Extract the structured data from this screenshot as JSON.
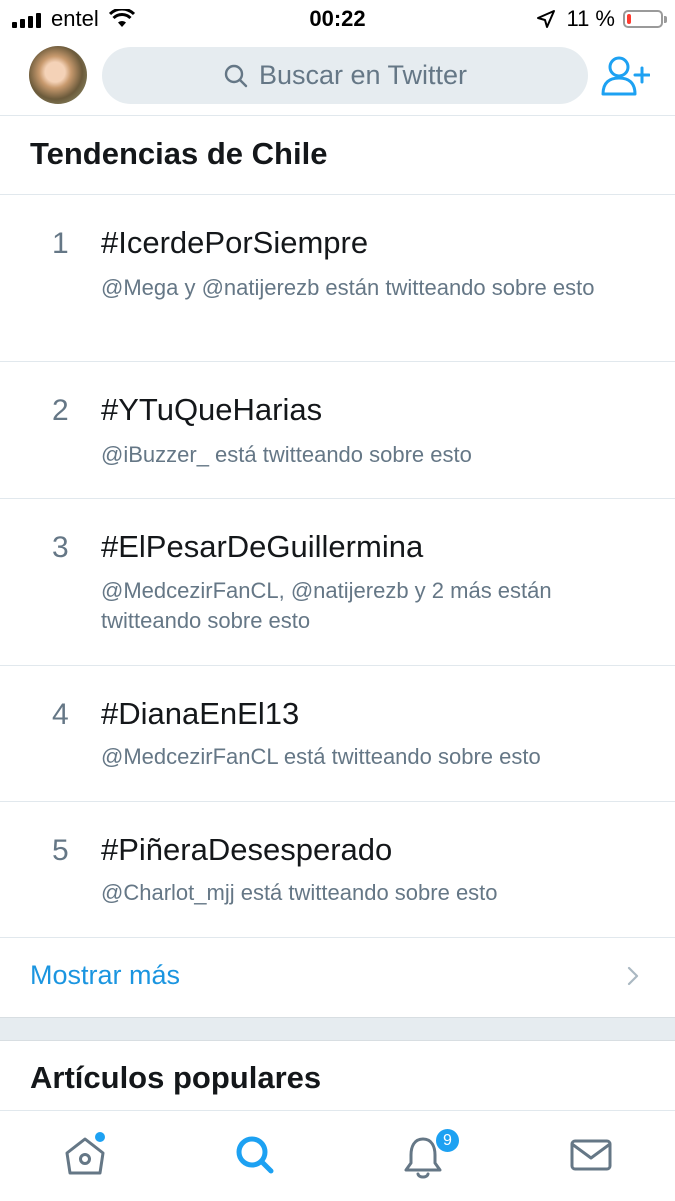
{
  "status_bar": {
    "carrier": "entel",
    "time": "00:22",
    "battery": "11 %",
    "battery_level": 0.11
  },
  "header": {
    "search_placeholder": "Buscar en Twitter"
  },
  "trends": {
    "title": "Tendencias de Chile",
    "items": [
      {
        "rank": "1",
        "tag": "#IcerdePorSiempre",
        "context": "@Mega y @natijerezb están twitteando sobre esto"
      },
      {
        "rank": "2",
        "tag": "#YTuQueHarias",
        "context": "@iBuzzer_ está twitteando sobre esto"
      },
      {
        "rank": "3",
        "tag": "#ElPesarDeGuillermina",
        "context": "@MedcezirFanCL, @natijerezb y 2 más están twitteando sobre esto"
      },
      {
        "rank": "4",
        "tag": "#DianaEnEl13",
        "context": "@MedcezirFanCL está twitteando sobre esto"
      },
      {
        "rank": "5",
        "tag": "#PiñeraDesesperado",
        "context": "@Charlot_mjj está twitteando sobre esto"
      }
    ],
    "show_more": "Mostrar más"
  },
  "popular": {
    "title": "Artículos populares"
  },
  "tabbar": {
    "notifications_count": "9"
  },
  "colors": {
    "accent": "#1da1f2",
    "link": "#1b95e0",
    "secondary_text": "#657786",
    "battery_low": "#ff3b30"
  }
}
